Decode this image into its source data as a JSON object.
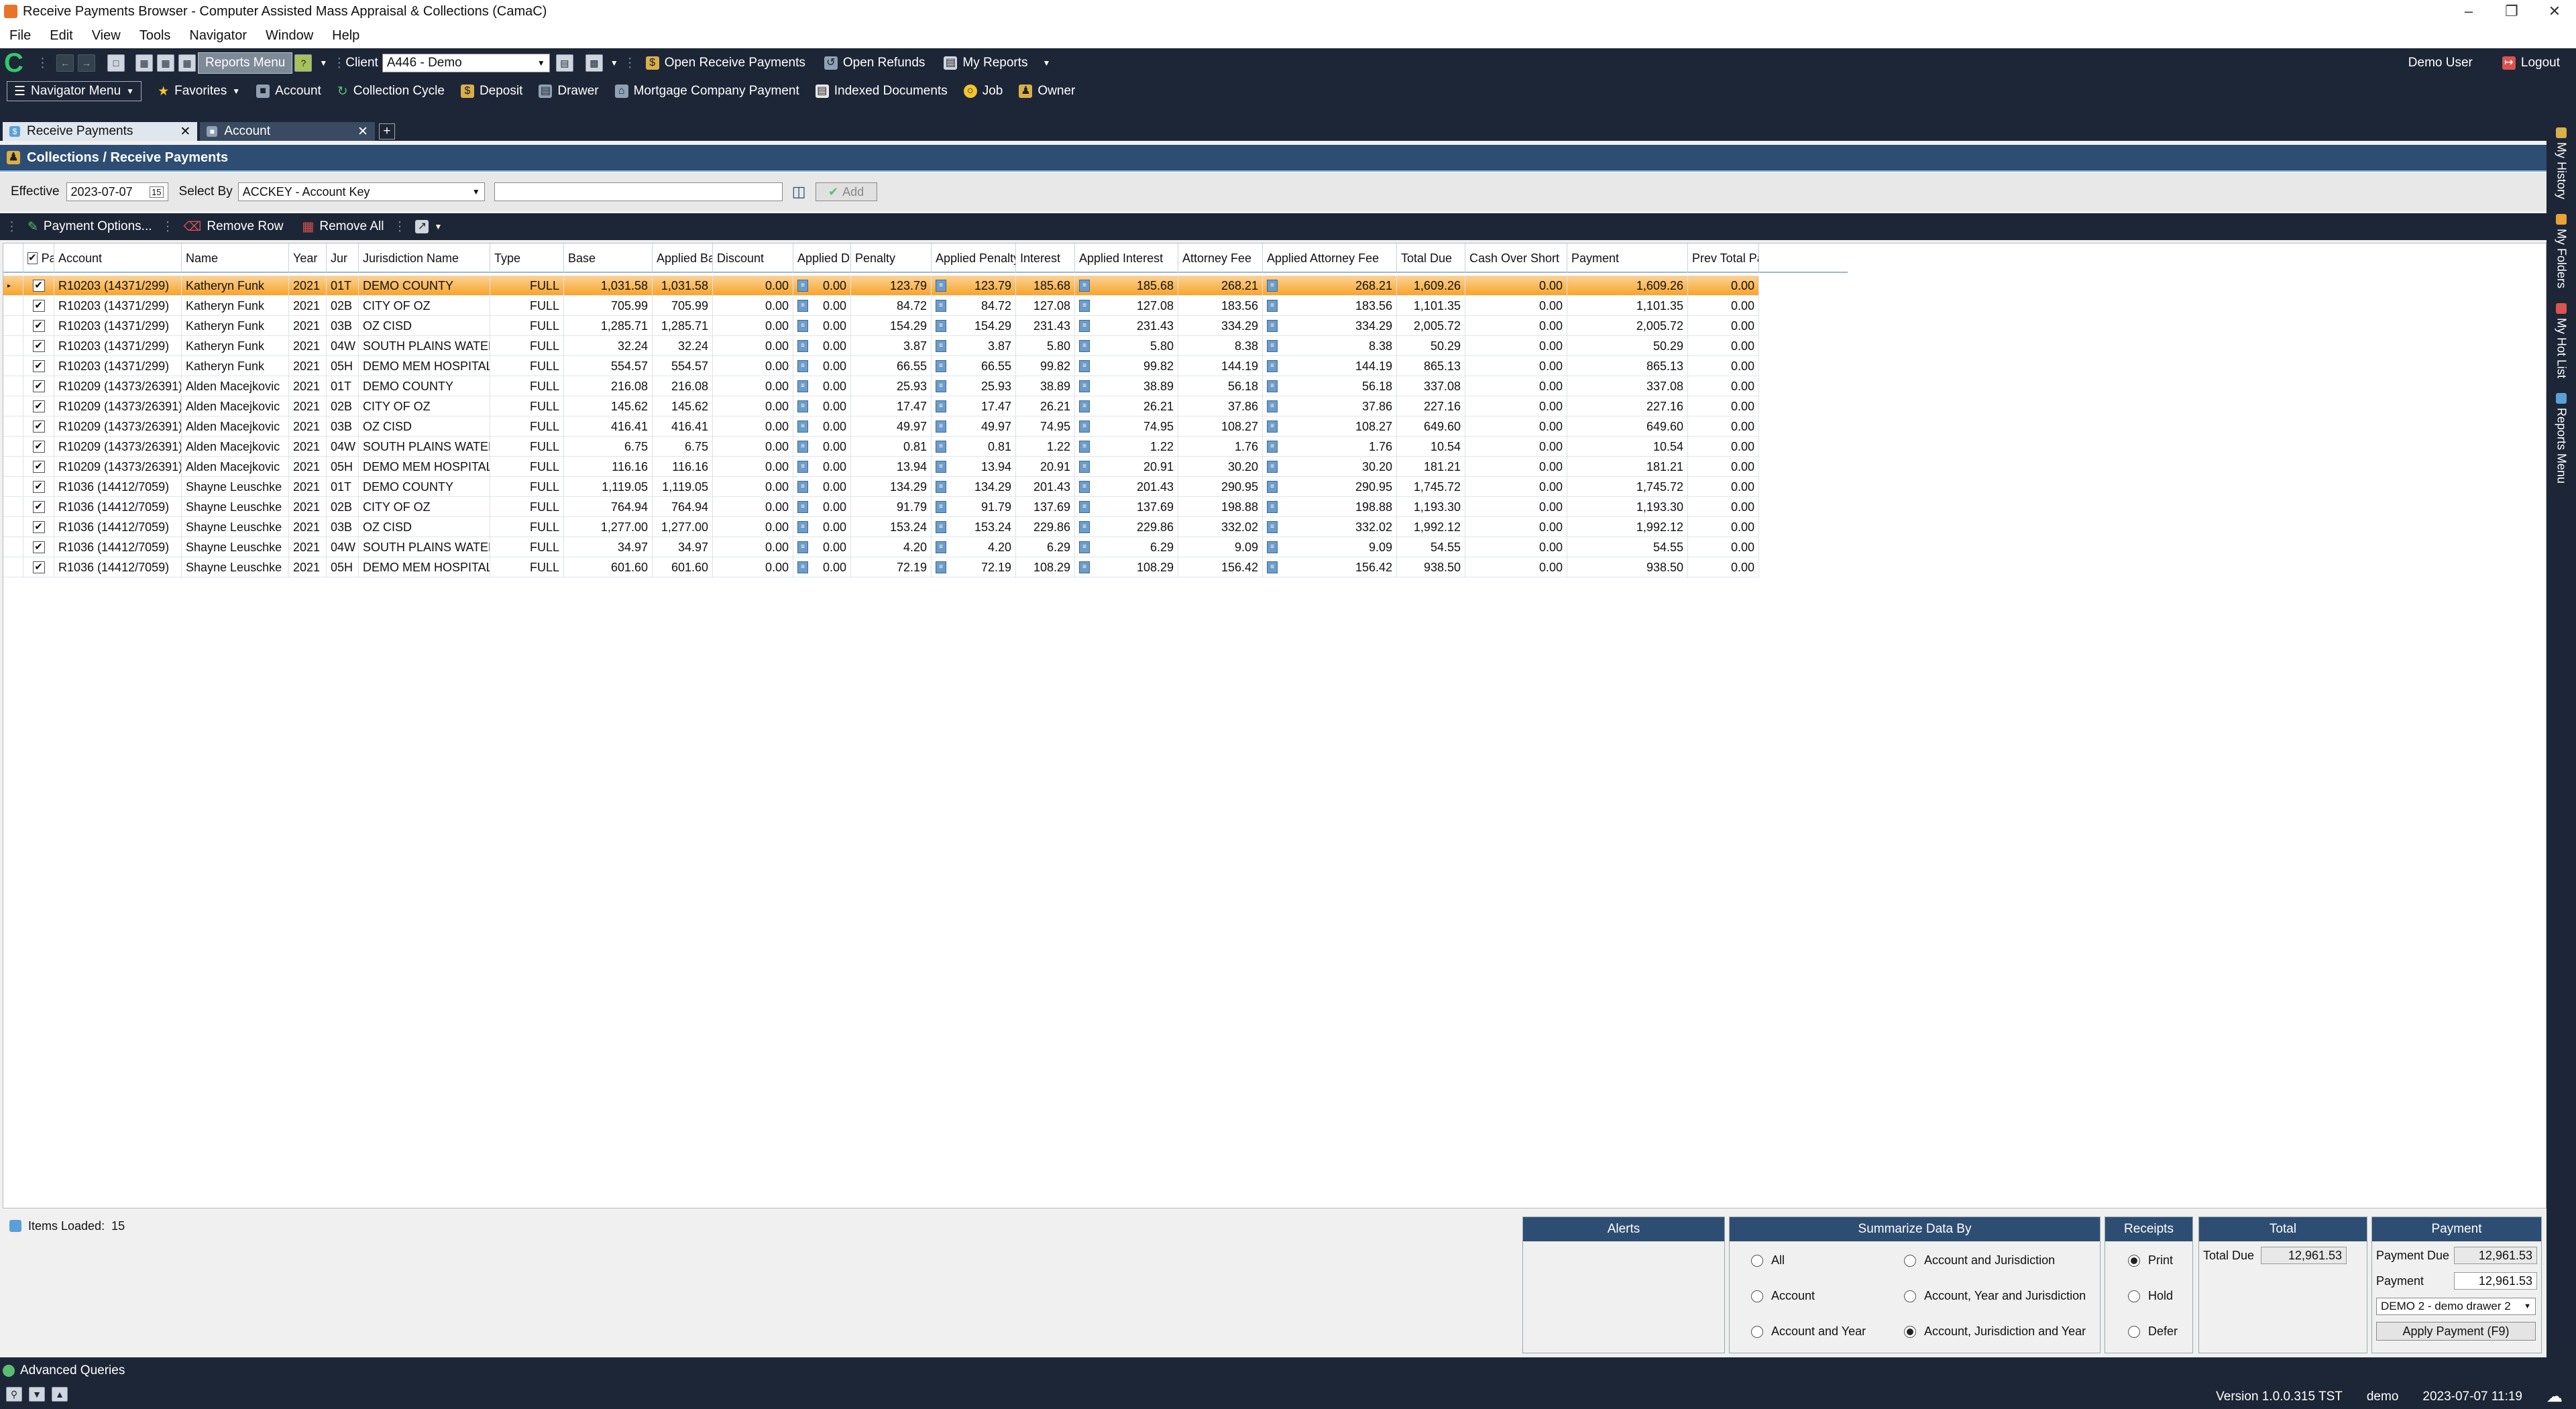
{
  "window": {
    "title": "Receive Payments Browser - Computer Assisted Mass Appraisal & Collections (CamaC)"
  },
  "menubar": [
    "File",
    "Edit",
    "View",
    "Tools",
    "Navigator",
    "Window",
    "Help"
  ],
  "toolbar": {
    "reports_menu": "Reports Menu",
    "client_label": "Client",
    "client_value": "A446 - Demo",
    "open_receive_payments": "Open Receive Payments",
    "open_refunds": "Open Refunds",
    "my_reports": "My Reports",
    "user": "Demo User",
    "logout": "Logout"
  },
  "navrow": {
    "navigator_menu": "Navigator Menu",
    "items": [
      "Favorites",
      "Account",
      "Collection Cycle",
      "Deposit",
      "Drawer",
      "Mortgage Company Payment",
      "Indexed Documents",
      "Job",
      "Owner"
    ]
  },
  "tabs": [
    {
      "label": "Receive Payments"
    },
    {
      "label": "Account"
    }
  ],
  "panel": {
    "title": "Collections / Receive Payments"
  },
  "filter": {
    "effective_label": "Effective",
    "effective_value": "2023-07-07",
    "calendar_day": "15",
    "select_by_label": "Select By",
    "select_by_value": "ACCKEY - Account Key",
    "search_value": "",
    "add_label": "Add"
  },
  "actions": {
    "payment_options": "Payment Options...",
    "remove_row": "Remove Row",
    "remove_all": "Remove All"
  },
  "grid": {
    "columns": [
      "Pay",
      "Account",
      "Name",
      "Year",
      "Jur",
      "Jurisdiction Name",
      "Type",
      "Base",
      "Applied Base",
      "Discount",
      "Applied Discount",
      "Penalty",
      "Applied Penalty",
      "Interest",
      "Applied Interest",
      "Attorney Fee",
      "Applied Attorney Fee",
      "Total Due",
      "Cash Over Short",
      "Payment",
      "Prev Total Paid"
    ],
    "rows": [
      [
        "R10203 (14371/299)",
        "Katheryn Funk",
        "2021",
        "01T",
        "DEMO COUNTY",
        "FULL",
        "1,031.58",
        "1,031.58",
        "0.00",
        "0.00",
        "123.79",
        "123.79",
        "185.68",
        "185.68",
        "268.21",
        "268.21",
        "1,609.26",
        "0.00",
        "1,609.26",
        "0.00"
      ],
      [
        "R10203 (14371/299)",
        "Katheryn Funk",
        "2021",
        "02B",
        "CITY OF OZ",
        "FULL",
        "705.99",
        "705.99",
        "0.00",
        "0.00",
        "84.72",
        "84.72",
        "127.08",
        "127.08",
        "183.56",
        "183.56",
        "1,101.35",
        "0.00",
        "1,101.35",
        "0.00"
      ],
      [
        "R10203 (14371/299)",
        "Katheryn Funk",
        "2021",
        "03B",
        "OZ CISD",
        "FULL",
        "1,285.71",
        "1,285.71",
        "0.00",
        "0.00",
        "154.29",
        "154.29",
        "231.43",
        "231.43",
        "334.29",
        "334.29",
        "2,005.72",
        "0.00",
        "2,005.72",
        "0.00"
      ],
      [
        "R10203 (14371/299)",
        "Katheryn Funk",
        "2021",
        "04W",
        "SOUTH PLAINS WATER",
        "FULL",
        "32.24",
        "32.24",
        "0.00",
        "0.00",
        "3.87",
        "3.87",
        "5.80",
        "5.80",
        "8.38",
        "8.38",
        "50.29",
        "0.00",
        "50.29",
        "0.00"
      ],
      [
        "R10203 (14371/299)",
        "Katheryn Funk",
        "2021",
        "05H",
        "DEMO MEM HOSPITAL",
        "FULL",
        "554.57",
        "554.57",
        "0.00",
        "0.00",
        "66.55",
        "66.55",
        "99.82",
        "99.82",
        "144.19",
        "144.19",
        "865.13",
        "0.00",
        "865.13",
        "0.00"
      ],
      [
        "R10209 (14373/26391)",
        "Alden Macejkovic",
        "2021",
        "01T",
        "DEMO COUNTY",
        "FULL",
        "216.08",
        "216.08",
        "0.00",
        "0.00",
        "25.93",
        "25.93",
        "38.89",
        "38.89",
        "56.18",
        "56.18",
        "337.08",
        "0.00",
        "337.08",
        "0.00"
      ],
      [
        "R10209 (14373/26391)",
        "Alden Macejkovic",
        "2021",
        "02B",
        "CITY OF OZ",
        "FULL",
        "145.62",
        "145.62",
        "0.00",
        "0.00",
        "17.47",
        "17.47",
        "26.21",
        "26.21",
        "37.86",
        "37.86",
        "227.16",
        "0.00",
        "227.16",
        "0.00"
      ],
      [
        "R10209 (14373/26391)",
        "Alden Macejkovic",
        "2021",
        "03B",
        "OZ CISD",
        "FULL",
        "416.41",
        "416.41",
        "0.00",
        "0.00",
        "49.97",
        "49.97",
        "74.95",
        "74.95",
        "108.27",
        "108.27",
        "649.60",
        "0.00",
        "649.60",
        "0.00"
      ],
      [
        "R10209 (14373/26391)",
        "Alden Macejkovic",
        "2021",
        "04W",
        "SOUTH PLAINS WATER",
        "FULL",
        "6.75",
        "6.75",
        "0.00",
        "0.00",
        "0.81",
        "0.81",
        "1.22",
        "1.22",
        "1.76",
        "1.76",
        "10.54",
        "0.00",
        "10.54",
        "0.00"
      ],
      [
        "R10209 (14373/26391)",
        "Alden Macejkovic",
        "2021",
        "05H",
        "DEMO MEM HOSPITAL",
        "FULL",
        "116.16",
        "116.16",
        "0.00",
        "0.00",
        "13.94",
        "13.94",
        "20.91",
        "20.91",
        "30.20",
        "30.20",
        "181.21",
        "0.00",
        "181.21",
        "0.00"
      ],
      [
        "R1036 (14412/7059)",
        "Shayne Leuschke",
        "2021",
        "01T",
        "DEMO COUNTY",
        "FULL",
        "1,119.05",
        "1,119.05",
        "0.00",
        "0.00",
        "134.29",
        "134.29",
        "201.43",
        "201.43",
        "290.95",
        "290.95",
        "1,745.72",
        "0.00",
        "1,745.72",
        "0.00"
      ],
      [
        "R1036 (14412/7059)",
        "Shayne Leuschke",
        "2021",
        "02B",
        "CITY OF OZ",
        "FULL",
        "764.94",
        "764.94",
        "0.00",
        "0.00",
        "91.79",
        "91.79",
        "137.69",
        "137.69",
        "198.88",
        "198.88",
        "1,193.30",
        "0.00",
        "1,193.30",
        "0.00"
      ],
      [
        "R1036 (14412/7059)",
        "Shayne Leuschke",
        "2021",
        "03B",
        "OZ CISD",
        "FULL",
        "1,277.00",
        "1,277.00",
        "0.00",
        "0.00",
        "153.24",
        "153.24",
        "229.86",
        "229.86",
        "332.02",
        "332.02",
        "1,992.12",
        "0.00",
        "1,992.12",
        "0.00"
      ],
      [
        "R1036 (14412/7059)",
        "Shayne Leuschke",
        "2021",
        "04W",
        "SOUTH PLAINS WATER",
        "FULL",
        "34.97",
        "34.97",
        "0.00",
        "0.00",
        "4.20",
        "4.20",
        "6.29",
        "6.29",
        "9.09",
        "9.09",
        "54.55",
        "0.00",
        "54.55",
        "0.00"
      ],
      [
        "R1036 (14412/7059)",
        "Shayne Leuschke",
        "2021",
        "05H",
        "DEMO MEM HOSPITAL",
        "FULL",
        "601.60",
        "601.60",
        "0.00",
        "0.00",
        "72.19",
        "72.19",
        "108.29",
        "108.29",
        "156.42",
        "156.42",
        "938.50",
        "0.00",
        "938.50",
        "0.00"
      ]
    ]
  },
  "status": {
    "items_loaded_label": "Items Loaded:",
    "items_loaded_value": "15"
  },
  "alerts": {
    "title": "Alerts"
  },
  "summarize": {
    "title": "Summarize Data By",
    "options": [
      "All",
      "Account and Jurisdiction",
      "Account",
      "Account, Year and Jurisdiction",
      "Account and Year",
      "Account, Jurisdiction and Year"
    ],
    "selected": "Account, Jurisdiction and Year"
  },
  "receipts": {
    "title": "Receipts",
    "options": [
      "Print",
      "Hold",
      "Defer"
    ],
    "selected": "Print"
  },
  "total": {
    "title": "Total",
    "label": "Total Due",
    "value": "12,961.53"
  },
  "payment": {
    "title": "Payment",
    "due_label": "Payment Due",
    "due_value": "12,961.53",
    "payment_label": "Payment",
    "payment_value": "12,961.53",
    "drawer": "DEMO 2 - demo drawer 2",
    "apply": "Apply Payment (F9)"
  },
  "bottom": {
    "advanced_queries": "Advanced Queries",
    "version": "Version 1.0.0.315 TST",
    "user": "demo",
    "datetime": "2023-07-07  11:19"
  },
  "sidebar": [
    "My History",
    "My Folders",
    "My Hot List",
    "Reports Menu"
  ]
}
